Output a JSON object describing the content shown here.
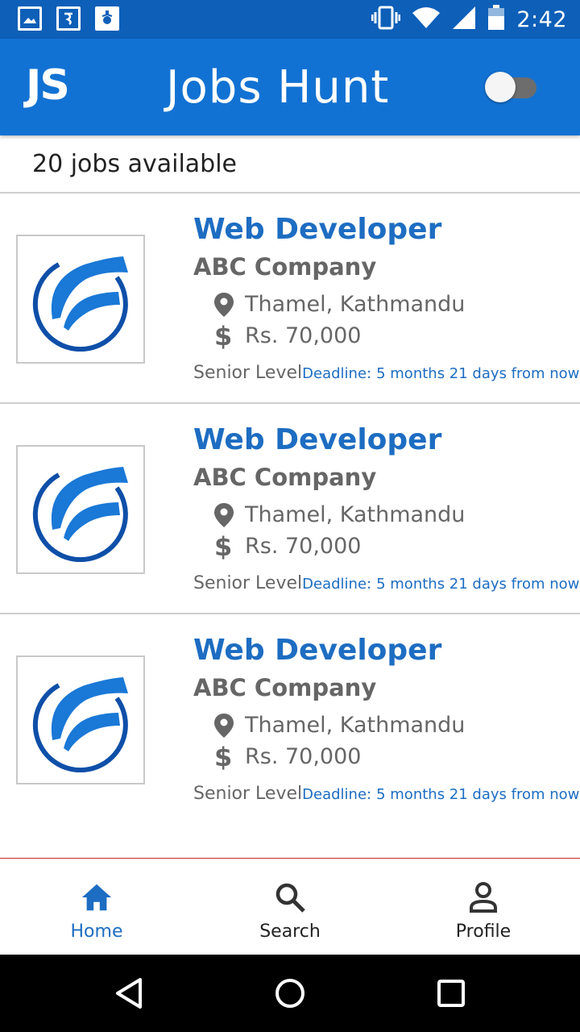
{
  "status_bar": {
    "time": "2:42",
    "notification_icons": [
      "image-icon",
      "e-app-icon",
      "app-icon"
    ],
    "system_icons": [
      "vibrate-icon",
      "wifi-icon",
      "signal-icon",
      "battery-icon"
    ]
  },
  "app_bar": {
    "logo": "JS",
    "title": "Jobs Hunt",
    "toggle_on": false
  },
  "summary": {
    "count_text": "20 jobs available"
  },
  "jobs": [
    {
      "title": "Web Developer",
      "company": "ABC Company",
      "location": "Thamel, Kathmandu",
      "salary_symbol": "$",
      "salary": "Rs. 70,000",
      "level": "Senior Level",
      "deadline_label": "Deadline:",
      "deadline_value": "5 months 21 days from now"
    },
    {
      "title": "Web Developer",
      "company": "ABC Company",
      "location": "Thamel, Kathmandu",
      "salary_symbol": "$",
      "salary": "Rs. 70,000",
      "level": "Senior Level",
      "deadline_label": "Deadline:",
      "deadline_value": "5 months 21 days from now"
    },
    {
      "title": "Web Developer",
      "company": "ABC Company",
      "location": "Thamel, Kathmandu",
      "salary_symbol": "$",
      "salary": "Rs. 70,000",
      "level": "Senior Level",
      "deadline_label": "Deadline:",
      "deadline_value": "5 months 21 days from now"
    }
  ],
  "bottom_nav": {
    "items": [
      {
        "label": "Home",
        "icon": "home-icon",
        "active": true
      },
      {
        "label": "Search",
        "icon": "search-icon",
        "active": false
      },
      {
        "label": "Profile",
        "icon": "person-icon",
        "active": false
      }
    ]
  },
  "system_nav": {
    "buttons": [
      "back-icon",
      "home-circle-icon",
      "recents-icon"
    ]
  },
  "colors": {
    "status_bar": "#0d5fb8",
    "app_bar": "#1272d3",
    "accent": "#1d6dc2",
    "divider": "#cfcfcf",
    "nav_border": "#c62828"
  }
}
